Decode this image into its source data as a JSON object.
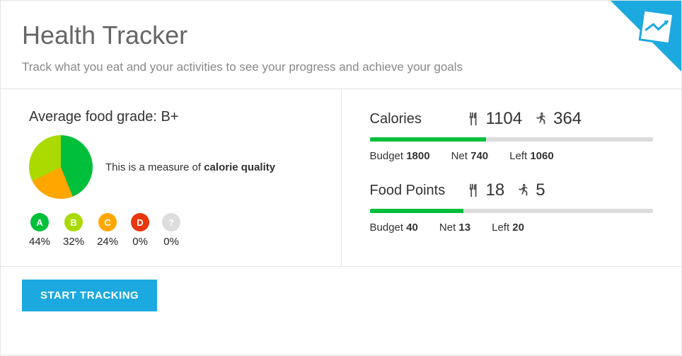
{
  "header": {
    "title": "Health Tracker",
    "subtitle": "Track what you eat and your activities to see your progress and achieve your goals"
  },
  "grade": {
    "label": "Average food grade: ",
    "value": "B+",
    "desc_prefix": "This is a measure of ",
    "desc_bold": "calorie quality",
    "badges": [
      {
        "letter": "A",
        "pct": "44%",
        "cls": "ba"
      },
      {
        "letter": "B",
        "pct": "32%",
        "cls": "bb"
      },
      {
        "letter": "C",
        "pct": "24%",
        "cls": "bc"
      },
      {
        "letter": "D",
        "pct": "0%",
        "cls": "bd"
      },
      {
        "letter": "?",
        "pct": "0%",
        "cls": "bq"
      }
    ]
  },
  "calories": {
    "name": "Calories",
    "eaten": "1104",
    "burned": "364",
    "budget_label": "Budget ",
    "budget": "1800",
    "net_label": "Net ",
    "net": "740",
    "left_label": "Left ",
    "left": "1060"
  },
  "points": {
    "name": "Food Points",
    "eaten": "18",
    "burned": "5",
    "budget_label": "Budget ",
    "budget": "40",
    "net_label": "Net ",
    "net": "13",
    "left_label": "Left ",
    "left": "20"
  },
  "cta": "START TRACKING",
  "chart_data": {
    "type": "pie",
    "title": "Average food grade",
    "categories": [
      "A",
      "B",
      "C",
      "D",
      "?"
    ],
    "values": [
      44,
      32,
      24,
      0,
      0
    ],
    "colors": [
      "#00bf3a",
      "#aada00",
      "#ffa700",
      "#e8370f",
      "#dddddd"
    ]
  }
}
